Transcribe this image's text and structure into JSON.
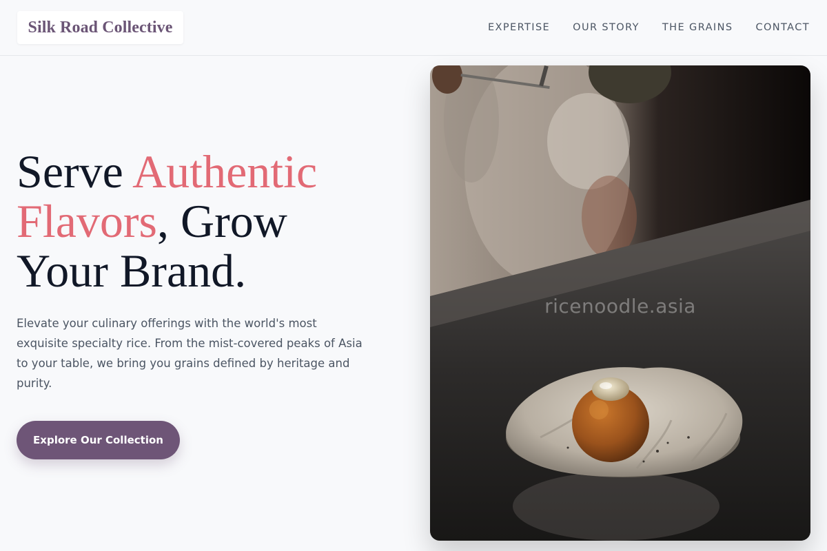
{
  "header": {
    "logo": "Silk Road Collective",
    "nav": [
      "EXPERTISE",
      "OUR STORY",
      "THE GRAINS",
      "CONTACT"
    ]
  },
  "hero": {
    "title_part1": "Serve ",
    "title_accent1": "Authentic",
    "title_accent2": "Flavors",
    "title_part2": ", Grow",
    "title_part3": "Your Brand.",
    "description": "Elevate your culinary offerings with the world's most exquisite specialty rice. From the mist-covered peaks of Asia to your table, we bring you grains defined by heritage and purity.",
    "cta_label": "Explore Our Collection"
  },
  "image": {
    "watermark": "ricenoodle.asia"
  },
  "colors": {
    "background": "#f8f9fb",
    "brand": "#6e5577",
    "accent": "#e26a75",
    "heading": "#111827"
  }
}
